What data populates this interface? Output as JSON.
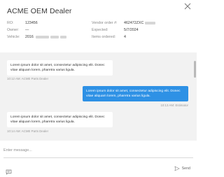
{
  "dialog": {
    "title": "ACME OEM Dealer",
    "close_icon": "close-icon"
  },
  "details": {
    "ro_label": "RO:",
    "ro_value": "123456",
    "owner_label": "Owner:",
    "owner_value": "—",
    "vehicle_label": "Vehicle:",
    "vehicle_value": "2016",
    "vendor_order_label": "Vendor order #:",
    "vendor_order_value": "462472ZXC",
    "expected_label": "Expected:",
    "expected_value": "5/7/2024",
    "items_ordered_label": "Items ordered:",
    "items_ordered_value": "4"
  },
  "messages": [
    {
      "direction": "in",
      "text": "Lorem ipsum dolor sit amet, consectetur adipiscing elit. Donec vitae aliquam lorem, pharetra varius ligula.",
      "meta": "10:12 AM: ACME Parts Dealer"
    },
    {
      "direction": "out",
      "text": "Lorem ipsum dolor sit amet, consectetur adipiscing elit. Donec vitae aliquam lorem, pharetra varius ligula.",
      "meta": "10:13 AM: Estimator"
    },
    {
      "direction": "in",
      "text": "Lorem ipsum dolor sit amet, consectetur adipiscing elit. Donec vitae aliquam lorem, pharetra varius ligula.",
      "meta": "10:14 AM: ACME Parts Dealer"
    }
  ],
  "composer": {
    "placeholder": "Enter message...",
    "value": "",
    "send_label": "Send",
    "chat_icon": "chat-bubble-icon",
    "send_icon": "send-icon"
  },
  "colors": {
    "accent": "#2e91e5",
    "chat_background": "#f2f2f2",
    "bubble_incoming": "#ffffff"
  }
}
